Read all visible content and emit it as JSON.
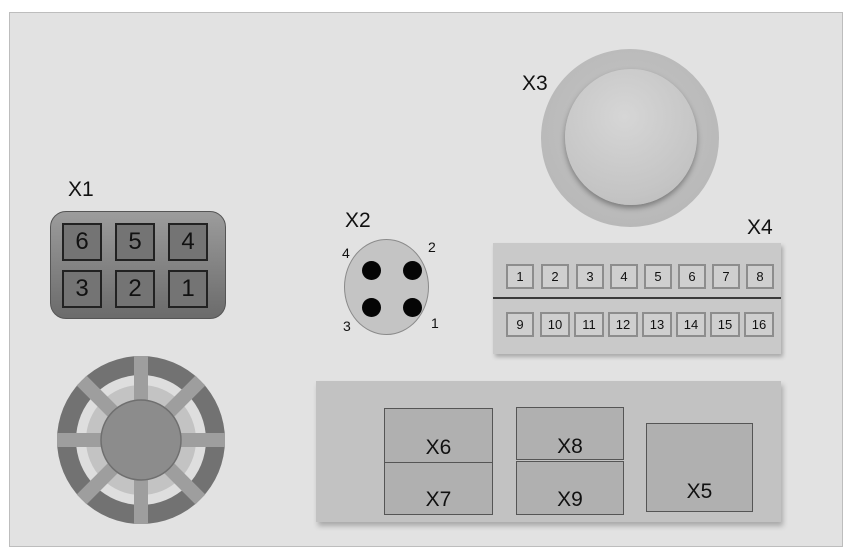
{
  "connectors": {
    "x1": {
      "label": "X1",
      "pins_top": [
        "6",
        "5",
        "4"
      ],
      "pins_bottom": [
        "3",
        "2",
        "1"
      ]
    },
    "x2": {
      "label": "X2",
      "pin_labels": [
        "4",
        "2",
        "3",
        "1"
      ]
    },
    "x3": {
      "label": "X3"
    },
    "x4": {
      "label": "X4",
      "row1": [
        "1",
        "2",
        "3",
        "4",
        "5",
        "6",
        "7",
        "8"
      ],
      "row2": [
        "9",
        "10",
        "11",
        "12",
        "13",
        "14",
        "15",
        "16"
      ]
    },
    "x5": {
      "label": "X5"
    },
    "x6": {
      "label": "X6"
    },
    "x7": {
      "label": "X7"
    },
    "x8": {
      "label": "X8"
    },
    "x9": {
      "label": "X9"
    }
  }
}
